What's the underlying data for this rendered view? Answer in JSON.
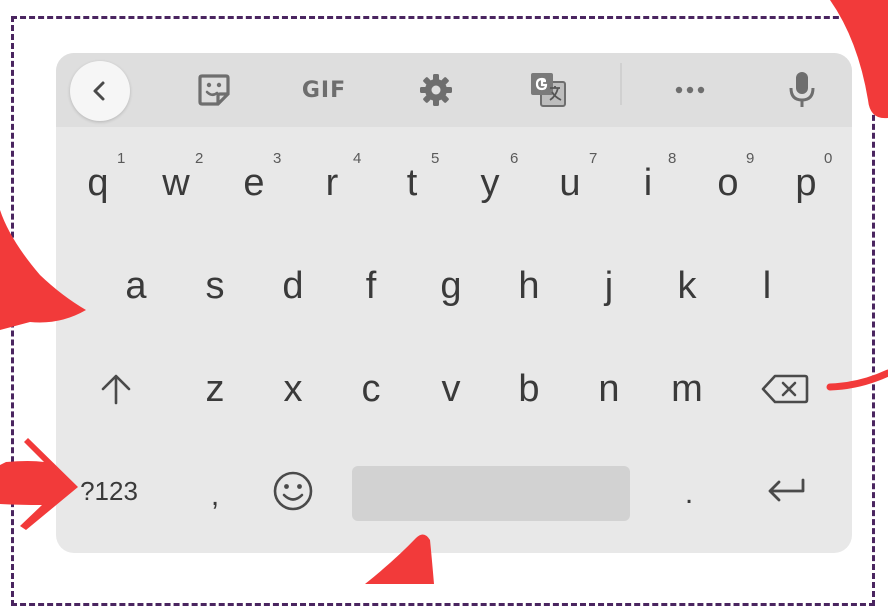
{
  "toolbar": {
    "items": [
      {
        "name": "back",
        "icon": "chevron-left-icon"
      },
      {
        "name": "sticker",
        "icon": "sticker-icon"
      },
      {
        "name": "gif",
        "label": "GIF"
      },
      {
        "name": "settings",
        "icon": "gear-icon"
      },
      {
        "name": "translate",
        "icon": "translate-icon"
      },
      {
        "name": "more",
        "icon": "more-horizontal-icon"
      },
      {
        "name": "voice",
        "icon": "microphone-icon"
      }
    ]
  },
  "rows": {
    "row1": [
      {
        "letter": "q",
        "hint": "1"
      },
      {
        "letter": "w",
        "hint": "2"
      },
      {
        "letter": "e",
        "hint": "3"
      },
      {
        "letter": "r",
        "hint": "4"
      },
      {
        "letter": "t",
        "hint": "5"
      },
      {
        "letter": "y",
        "hint": "6"
      },
      {
        "letter": "u",
        "hint": "7"
      },
      {
        "letter": "i",
        "hint": "8"
      },
      {
        "letter": "o",
        "hint": "9"
      },
      {
        "letter": "p",
        "hint": "0"
      }
    ],
    "row2": [
      "a",
      "s",
      "d",
      "f",
      "g",
      "h",
      "j",
      "k",
      "l"
    ],
    "row3": [
      "z",
      "x",
      "c",
      "v",
      "b",
      "n",
      "m"
    ],
    "row4": {
      "symbols_label": "?123",
      "comma": ",",
      "period": "."
    }
  },
  "icons": {
    "shift": "shift-icon",
    "backspace": "backspace-icon",
    "emoji": "emoji-icon",
    "enter": "enter-icon"
  },
  "colors": {
    "keyboard_bg": "#e8e8e8",
    "toolbar_bg": "#dedede",
    "key_text": "#3a3a3a",
    "annotation_arrow": "#f23a3a",
    "frame_border": "#4a2560"
  }
}
